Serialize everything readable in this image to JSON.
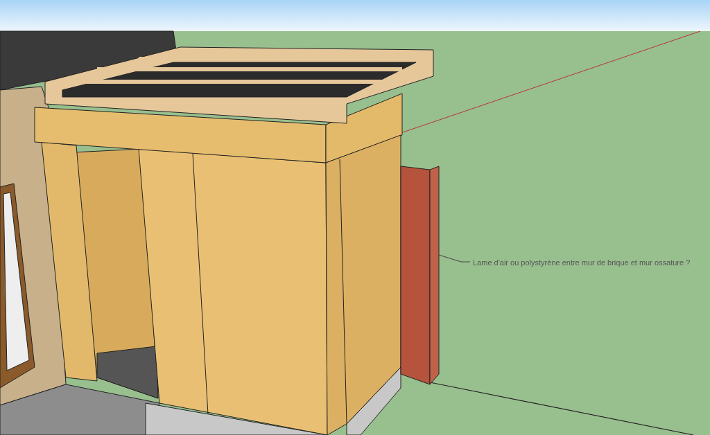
{
  "viewport": {
    "annotation": {
      "text": "Lame d'air ou polystyrène entre mur de brique et mur ossature ?"
    }
  }
}
